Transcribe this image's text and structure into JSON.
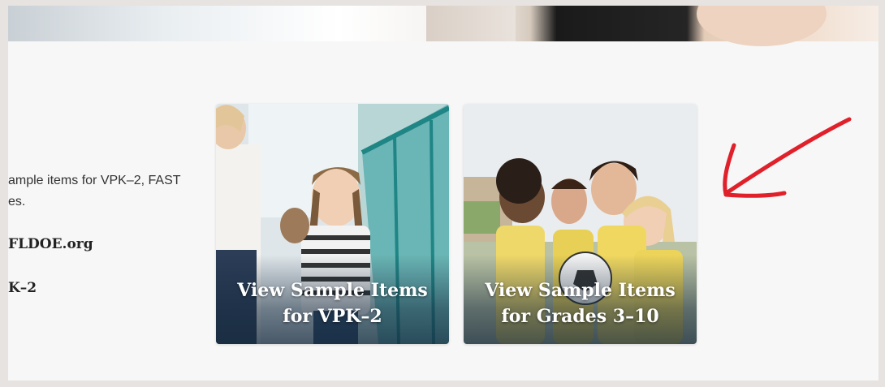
{
  "content": {
    "description": "ample items for VPK–2, FAST\nes.",
    "fldoe_link": "FLDOE.org",
    "vpk_label": "K–2"
  },
  "cards": [
    {
      "title_line1": "View Sample Items",
      "title_line2": "for VPK–2"
    },
    {
      "title_line1": "View Sample Items",
      "title_line2": "for Grades 3–10"
    }
  ],
  "annotation": {
    "type": "red-arrow-icon",
    "color": "#e0202a"
  },
  "colors": {
    "teal_rail": "#2a9a9a",
    "card_overlay": "#14283c",
    "page_bg": "#f7f7f7"
  }
}
